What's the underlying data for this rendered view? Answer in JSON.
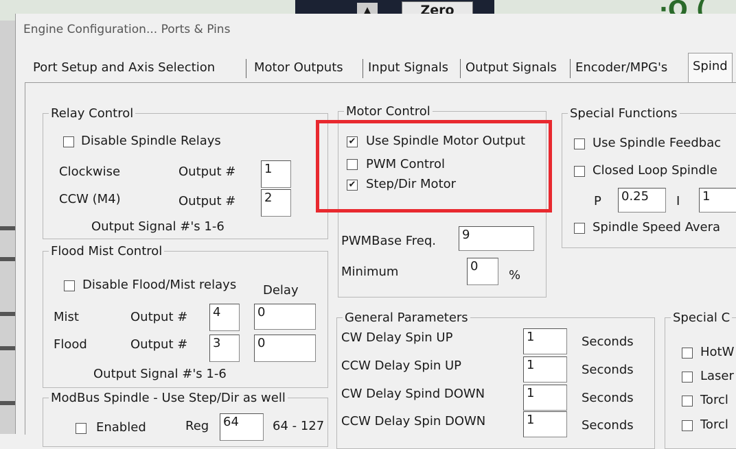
{
  "background": {
    "zero_label": "Zero",
    "arrow_icon": "up-arrow"
  },
  "dialog": {
    "title": "Engine Configuration... Ports & Pins"
  },
  "tabs": [
    "Port Setup and Axis Selection",
    "Motor Outputs",
    "Input Signals",
    "Output Signals",
    "Encoder/MPG's",
    "Spind"
  ],
  "relay": {
    "title": "Relay Control",
    "disable_label": "Disable Spindle Relays",
    "disable_checked": false,
    "cw_label": "Clockwise",
    "cw_output_label": "Output #",
    "cw_value": "1",
    "ccw_label": "CCW (M4)",
    "ccw_output_label": "Output #",
    "ccw_value": "2",
    "note": "Output Signal #'s 1-6"
  },
  "flood": {
    "title": "Flood Mist Control",
    "disable_label": "Disable Flood/Mist relays",
    "disable_checked": false,
    "delay_label": "Delay",
    "mist_label": "Mist",
    "mist_output_label": "Output #",
    "mist_value": "4",
    "mist_delay": "0",
    "flood_label": "Flood",
    "flood_output_label": "Output #",
    "flood_value": "3",
    "flood_delay": "0",
    "note": "Output Signal #'s 1-6"
  },
  "modbus": {
    "title": "ModBus Spindle - Use Step/Dir as well",
    "enabled_label": "Enabled",
    "enabled_checked": false,
    "reg_label": "Reg",
    "reg_value": "64",
    "range_label": "64 - 127"
  },
  "motor": {
    "title": "Motor Control",
    "use_output_label": "Use Spindle Motor Output",
    "use_output_checked": true,
    "pwm_label": "PWM Control",
    "pwm_checked": false,
    "stepdir_label": "Step/Dir Motor",
    "stepdir_checked": true,
    "pwm_freq_label": "PWMBase Freq.",
    "pwm_freq_value": "9",
    "minimum_label": "Minimum",
    "minimum_value": "0",
    "percent_label": "%"
  },
  "special": {
    "title": "Special Functions",
    "feedback_label": "Use Spindle Feedbac",
    "feedback_checked": false,
    "closed_loop_label": "Closed Loop Spindle",
    "closed_loop_checked": false,
    "p_label": "P",
    "p_value": "0.25",
    "i_label": "I",
    "i_value": "1",
    "avg_label": "Spindle Speed Avera",
    "avg_checked": false
  },
  "general": {
    "title": "General Parameters",
    "rows": [
      {
        "label": "CW Delay Spin UP",
        "value": "1",
        "unit": "Seconds"
      },
      {
        "label": "CCW Delay Spin UP",
        "value": "1",
        "unit": "Seconds"
      },
      {
        "label": "CW Delay Spind DOWN",
        "value": "1",
        "unit": "Seconds"
      },
      {
        "label": "CCW Delay Spin DOWN",
        "value": "1",
        "unit": "Seconds"
      }
    ]
  },
  "special2": {
    "title": "Special C",
    "items": [
      "HotW",
      "Laser",
      "Torcl",
      "Torcl"
    ]
  },
  "colors": {
    "highlight": "#e8292f"
  }
}
